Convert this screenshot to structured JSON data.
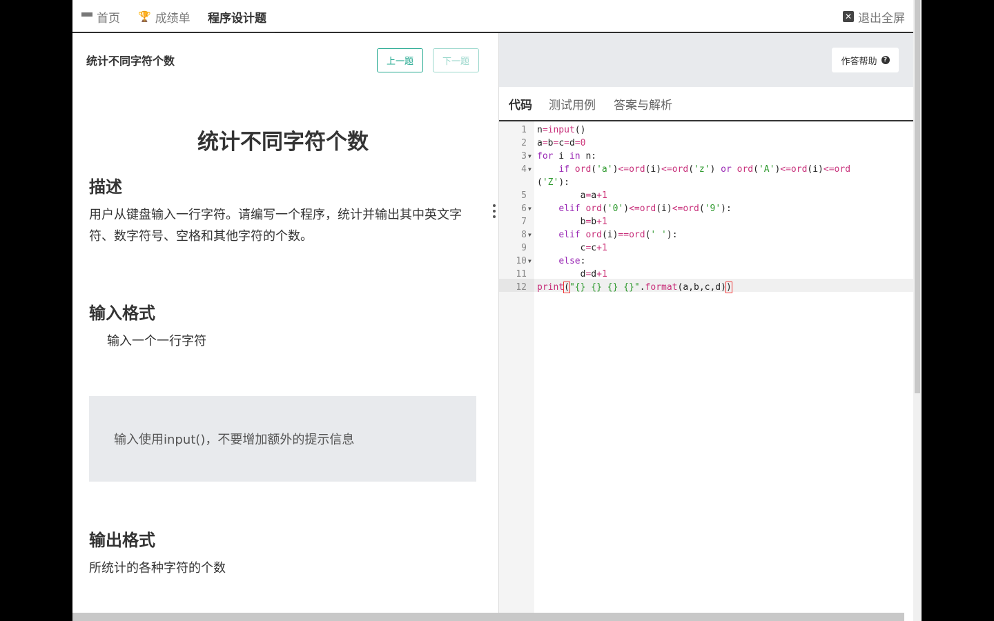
{
  "topnav": {
    "home": "首页",
    "scores": "成绩单",
    "programming": "程序设计题",
    "exit_fullscreen": "退出全屏"
  },
  "problem": {
    "header_title": "统计不同字符个数",
    "prev_label": "上一题",
    "next_label": "下一题",
    "title": "统计不同字符个数",
    "desc_heading": "描述",
    "desc_text": "用户从键盘输入一行字符。请编写一个程序，统计并输出其中英文字符、数字符号、空格和其他字符的个数。",
    "input_heading": "输入格式",
    "input_text": "输入一个一行字符",
    "tip_text": "输入使用input()，不要增加额外的提示信息",
    "output_heading": "输出格式",
    "output_text": "所统计的各种字符的个数"
  },
  "editor_panel": {
    "help_label": "作答帮助",
    "tabs": [
      "代码",
      "测试用例",
      "答案与解析"
    ],
    "line_numbers": [
      "1",
      "2",
      "3",
      "4",
      "5",
      "6",
      "7",
      "8",
      "9",
      "10",
      "11",
      "12"
    ]
  },
  "colors": {
    "accent": "#22a88f",
    "keyword": "#9a2ab5",
    "string": "#2f9a2f",
    "number": "#cc3377"
  },
  "icons": [
    "menu-icon",
    "trophy-icon",
    "close-box-icon",
    "question-circle-icon",
    "fold-arrow-icon"
  ]
}
